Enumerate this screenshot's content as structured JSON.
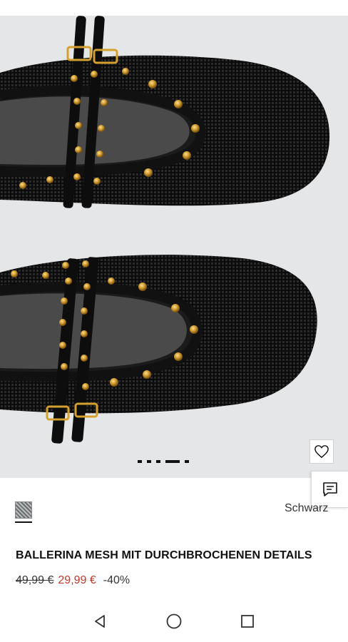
{
  "product": {
    "image_alt": "",
    "title": "BALLERINA MESH MIT DURCHBROCHENEN DETAILS",
    "color_name": "Schwarz",
    "price_old": "49,99 €",
    "price_new": "29,99 €",
    "discount": "-40%"
  },
  "gallery": {
    "image_count": 5,
    "active_index": 3
  },
  "icons": {
    "wishlist": "heart-icon",
    "chat": "chat-icon",
    "back": "triangle-back-icon",
    "home": "circle-home-icon",
    "recents": "square-recents-icon"
  },
  "colors": {
    "sale_price": "#c0392b",
    "image_background": "#e4e6e7"
  }
}
